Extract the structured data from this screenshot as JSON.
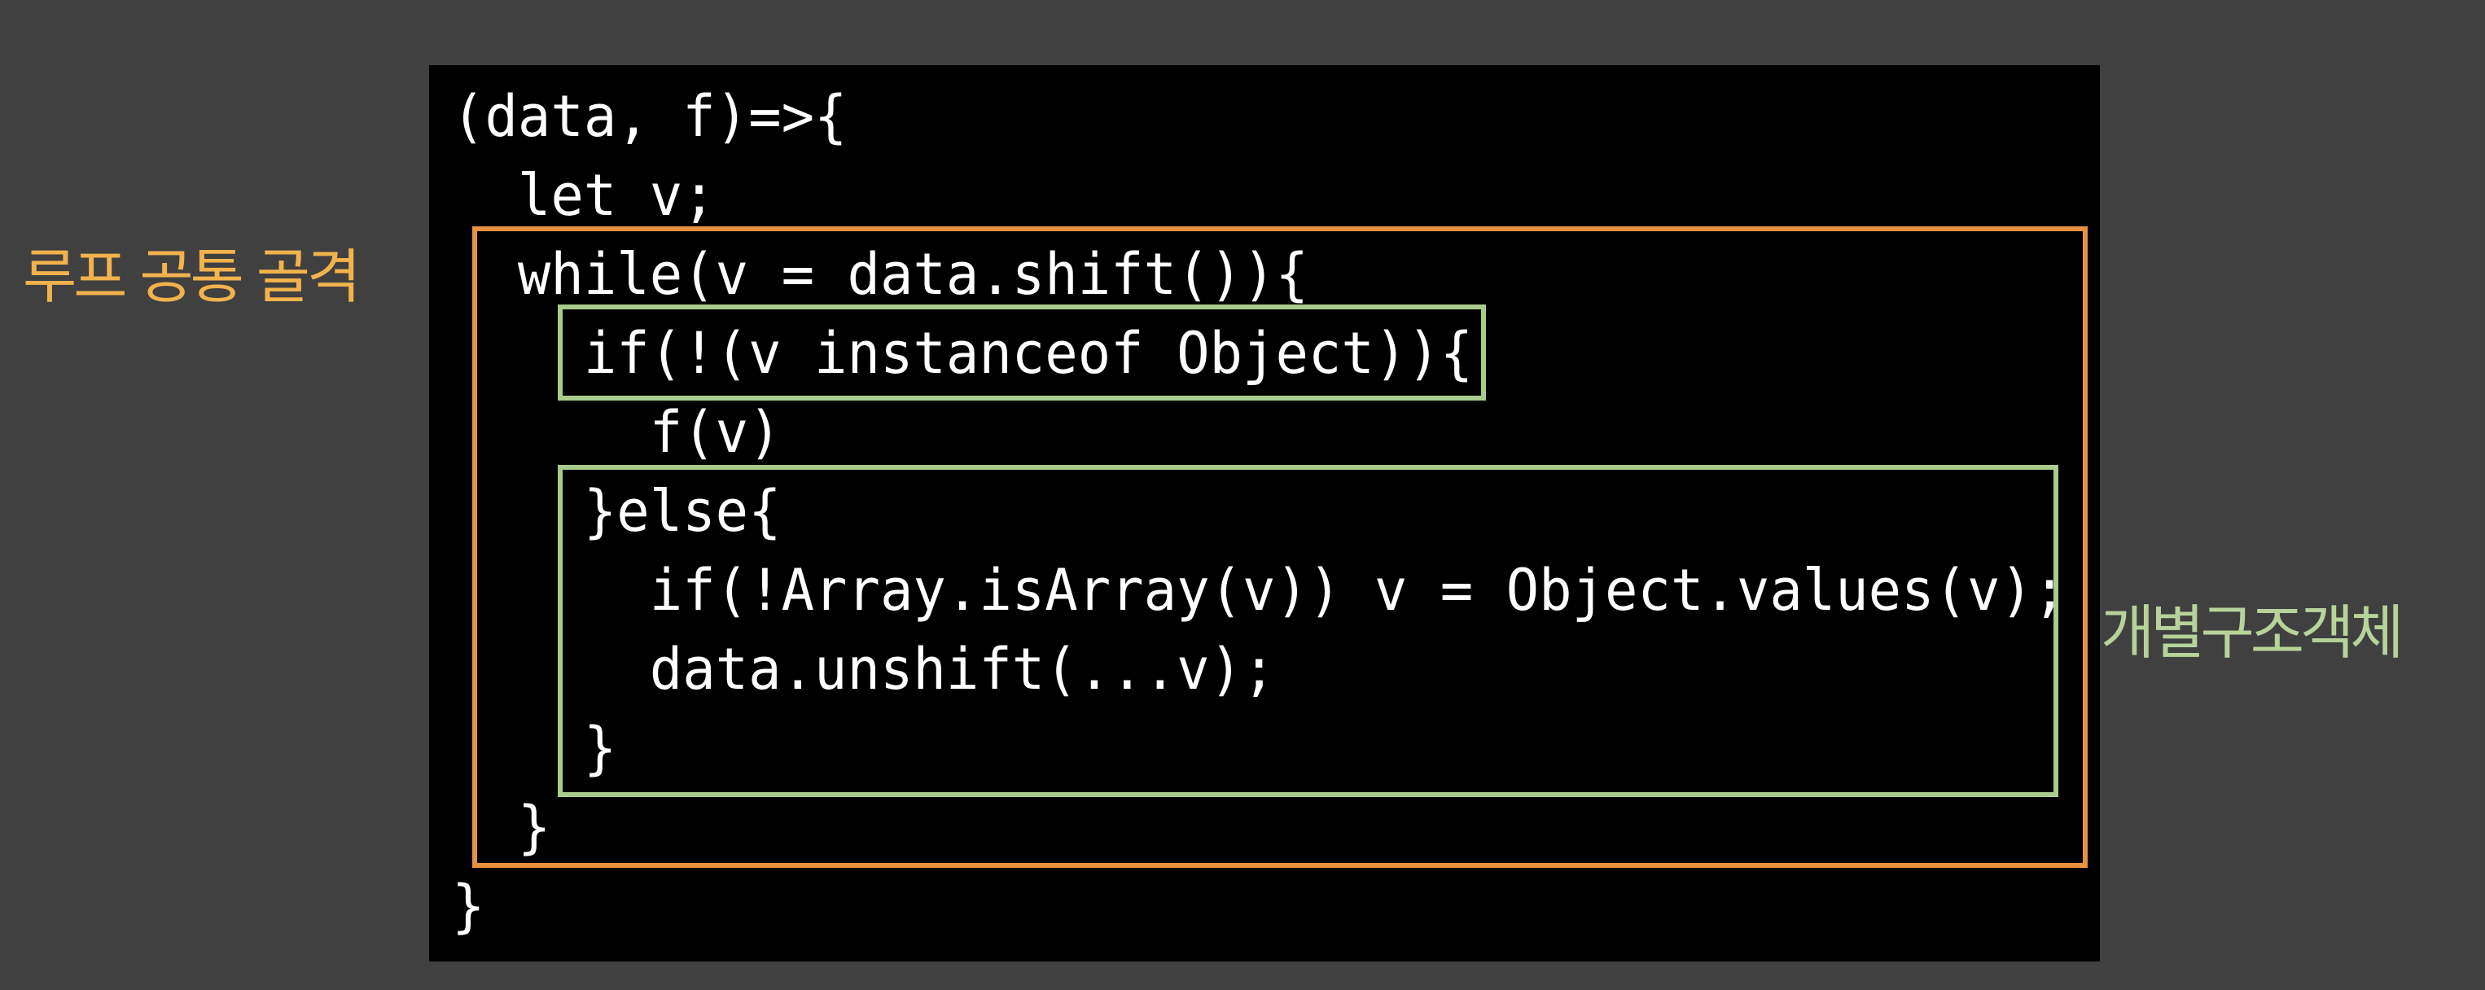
{
  "code": {
    "lines": [
      "(data, f)=>{",
      "  let v;",
      "  while(v = data.shift()){",
      "    if(!(v instanceof Object)){",
      "      f(v)",
      "    }else{",
      "      if(!Array.isArray(v)) v = Object.values(v);",
      "      data.unshift(...v);",
      "    }",
      "  }",
      "}"
    ]
  },
  "labels": {
    "loop_skeleton": "루프 공통 골격",
    "structure_object": "개별구조객체"
  },
  "colors": {
    "background": "#404040",
    "panel": "#000000",
    "code_text": "#ffffff",
    "loop_box": "#e8913f",
    "structure_box": "#a8cc8c",
    "loop_label": "#f2b24c",
    "structure_label": "#b7d39a"
  }
}
